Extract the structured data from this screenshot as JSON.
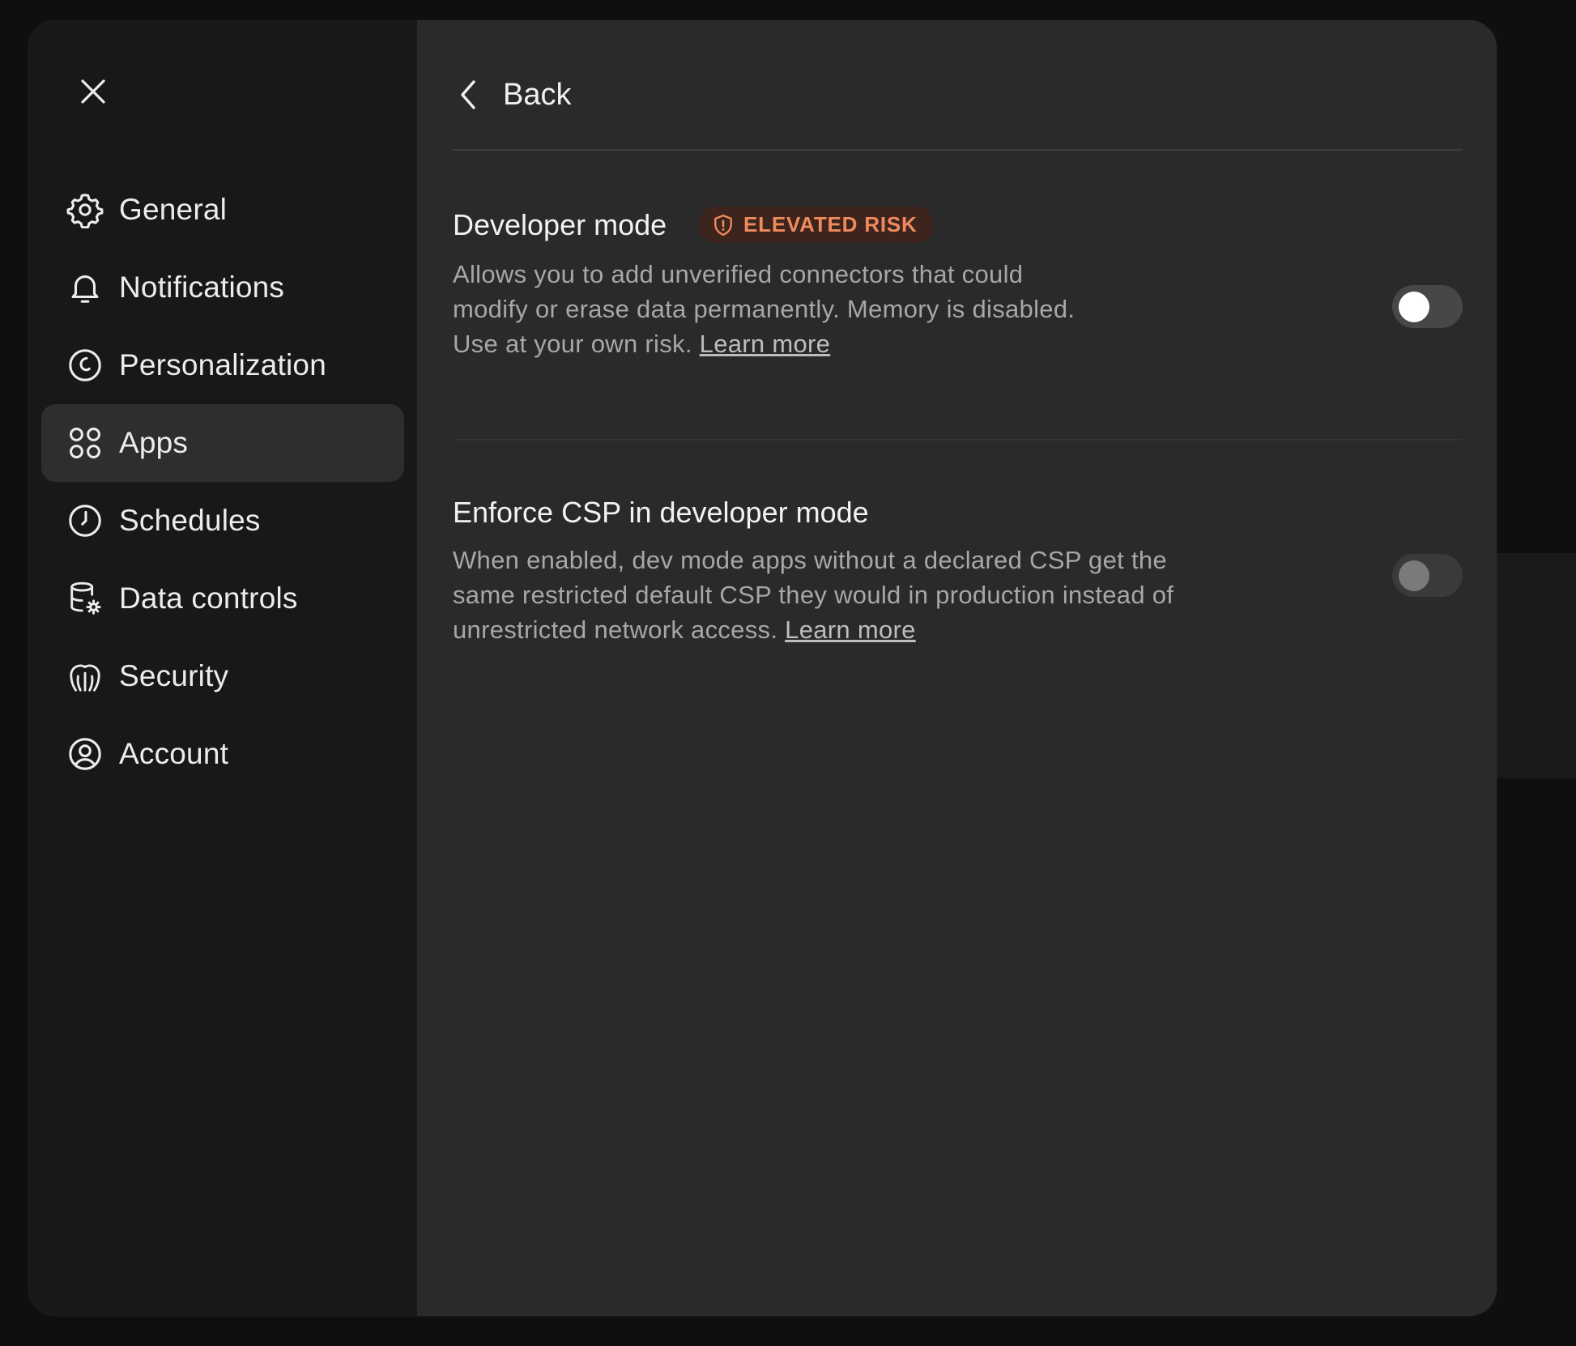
{
  "sidebar": {
    "close_icon": "close-icon",
    "items": [
      {
        "label": "General",
        "icon": "gear-icon"
      },
      {
        "label": "Notifications",
        "icon": "bell-icon"
      },
      {
        "label": "Personalization",
        "icon": "personalization-icon"
      },
      {
        "label": "Apps",
        "icon": "apps-grid-icon",
        "active": true
      },
      {
        "label": "Schedules",
        "icon": "clock-icon"
      },
      {
        "label": "Data controls",
        "icon": "database-gear-icon"
      },
      {
        "label": "Security",
        "icon": "security-icon"
      },
      {
        "label": "Account",
        "icon": "user-circle-icon"
      }
    ]
  },
  "header": {
    "back_label": "Back",
    "back_icon": "chevron-left-icon"
  },
  "settings": [
    {
      "title": "Developer mode",
      "badge": "ELEVATED RISK",
      "badge_icon": "shield-alert-icon",
      "description": "Allows you to add unverified connectors that could modify or erase data permanently. Memory is disabled. Use at your own risk.",
      "link": "Learn more",
      "enabled": false
    },
    {
      "title": "Enforce CSP in developer mode",
      "description": "When enabled, dev mode apps without a declared CSP get the same restricted default CSP they would in production instead of unrestricted network access.",
      "link": "Learn more",
      "enabled": false,
      "disabled": true
    }
  ],
  "colors": {
    "background": "#0f0f0f",
    "sidebar": "#181818",
    "panel": "#2a2a2a",
    "active_item": "#2e2e2e",
    "badge_text": "#f08a5d",
    "badge_bg": "#3d241d"
  }
}
